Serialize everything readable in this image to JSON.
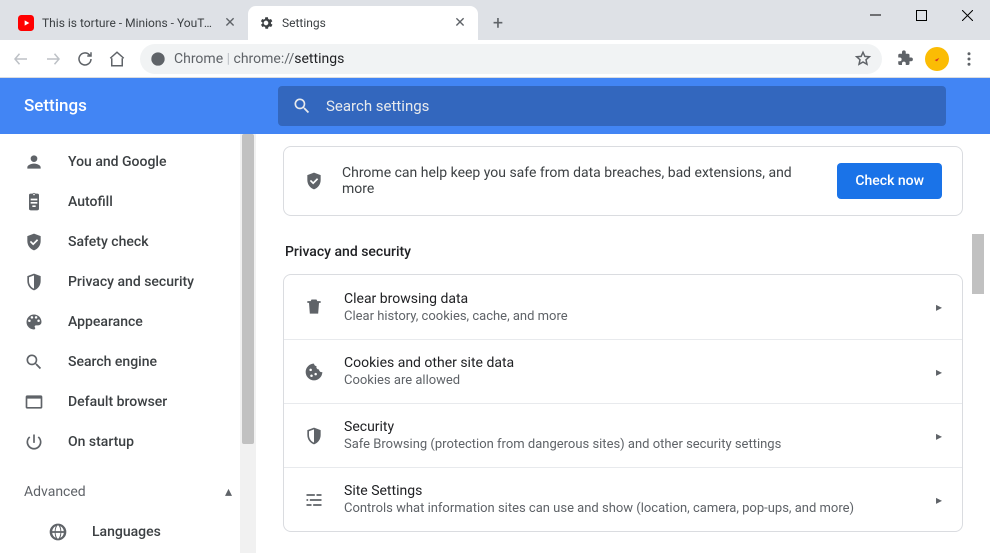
{
  "tabs": [
    {
      "title": "This is torture - Minions - YouTube",
      "favicon": "youtube"
    },
    {
      "title": "Settings",
      "favicon": "settings"
    }
  ],
  "omnibox": {
    "prefix_label": "Chrome",
    "url_prefix": "chrome://",
    "url_path": "settings"
  },
  "settings_title": "Settings",
  "search_placeholder": "Search settings",
  "sidebar": {
    "items": [
      {
        "icon": "person",
        "label": "You and Google"
      },
      {
        "icon": "clipboard",
        "label": "Autofill"
      },
      {
        "icon": "shield-check",
        "label": "Safety check"
      },
      {
        "icon": "shield",
        "label": "Privacy and security"
      },
      {
        "icon": "palette",
        "label": "Appearance"
      },
      {
        "icon": "search",
        "label": "Search engine"
      },
      {
        "icon": "window",
        "label": "Default browser"
      },
      {
        "icon": "power",
        "label": "On startup"
      }
    ],
    "advanced_label": "Advanced",
    "sub_items": [
      {
        "icon": "globe",
        "label": "Languages"
      }
    ]
  },
  "banner": {
    "text": "Chrome can help keep you safe from data breaches, bad extensions, and more",
    "button": "Check now"
  },
  "section_title": "Privacy and security",
  "rows": [
    {
      "icon": "trash",
      "title": "Clear browsing data",
      "sub": "Clear history, cookies, cache, and more"
    },
    {
      "icon": "cookie",
      "title": "Cookies and other site data",
      "sub": "Cookies are allowed"
    },
    {
      "icon": "shield",
      "title": "Security",
      "sub": "Safe Browsing (protection from dangerous sites) and other security settings"
    },
    {
      "icon": "sliders",
      "title": "Site Settings",
      "sub": "Controls what information sites can use and show (location, camera, pop-ups, and more)"
    }
  ]
}
